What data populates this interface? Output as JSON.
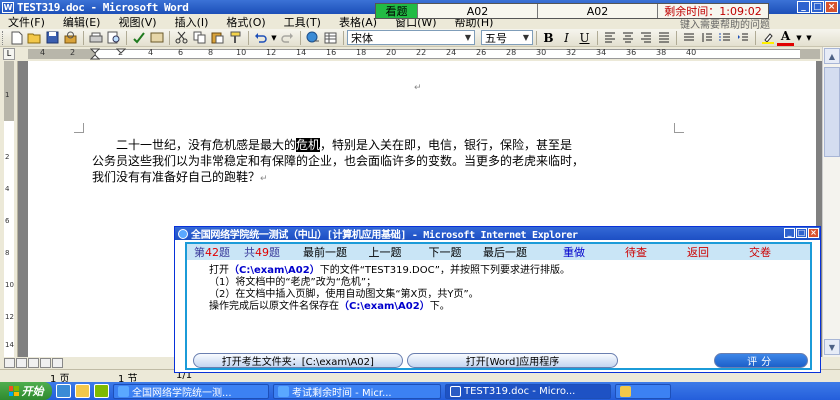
{
  "window": {
    "title": "TEST319.doc - Microsoft Word",
    "icon_label": "W"
  },
  "exam_bar": {
    "watch_label": "看题",
    "answer_1": "A02",
    "answer_2": "A02",
    "timer": "剩余时间：1:09:02"
  },
  "help_hint": "键入需要帮助的问题",
  "menu": [
    "文件(F)",
    "编辑(E)",
    "视图(V)",
    "插入(I)",
    "格式(O)",
    "工具(T)",
    "表格(A)",
    "窗口(W)",
    "帮助(H)"
  ],
  "toolbar": {
    "font_name": "宋体",
    "font_size": "五号",
    "bold": "B",
    "italic": "I",
    "underline": "U",
    "font_color": "A",
    "arrow": "▼"
  },
  "ruler": {
    "numbers": [
      "4",
      "2",
      "2",
      "4",
      "6",
      "8",
      "10",
      "12",
      "14",
      "16",
      "18",
      "20",
      "22",
      "24",
      "26",
      "28",
      "30",
      "32",
      "34",
      "36",
      "38",
      "40"
    ],
    "vertical_numbers": [
      "1",
      "2",
      "4",
      "6",
      "8",
      "10",
      "12",
      "14"
    ]
  },
  "document": {
    "paragraph_mark": "↵",
    "line1_before": "二十一世纪，没有危机感是最大的",
    "selected": "危机",
    "line1_after": "，特别是入关在即，电信，银行，保险，甚至是",
    "line2": "公务员这些我们以为非常稳定和有保障的企业，也会面临许多的变数。当更多的老虎来临时，",
    "line3": "我们没有有准备好自己的跑鞋？"
  },
  "statusbar": {
    "page": "1 页",
    "section": "1 节",
    "pos": "1/1"
  },
  "taskbar": {
    "start": "开始",
    "items": [
      "全国网络学院统一测...",
      "考试剩余时间 - Micr...",
      "TEST319.doc - Micro...",
      ""
    ]
  },
  "exam_dialog": {
    "title": "全国网络学院统一测试（中山）[计算机应用基础] - Microsoft Internet Explorer",
    "nav": {
      "current_prefix": "第",
      "current_num": "42",
      "current_suffix": "题",
      "total_prefix": "共",
      "total_num": "49",
      "total_suffix": "题",
      "first": "最前一题",
      "prev": "上一题",
      "next": "下一题",
      "last": "最后一题",
      "redo": "重做",
      "review": "待查",
      "back": "返回",
      "submit": "交卷"
    },
    "instructions": {
      "line1_a": "打开",
      "line1_path": "（C:\\exam\\A02）",
      "line1_b": "下的文件“TEST319.DOC”，并按照下列要求进行排版。",
      "line2": "（1）将文档中的“老虎”改为“危机”；",
      "line3": "（2）在文档中插入页脚，使用自动图文集“第X页，共Y页”。",
      "line4_a": "操作完成后以原文件名保存在",
      "line4_path": "（C:\\exam\\A02）",
      "line4_b": "下。"
    },
    "buttons": {
      "open_folder": "打开考生文件夹：[C:\\exam\\A02]",
      "open_app": "打开[Word]应用程序",
      "score": "评分"
    }
  },
  "colors": {
    "title_blue": "#1c4fb8",
    "watch_green": "#22bb44",
    "timer_red": "#c00000",
    "nav_bg": "#c9e5f6",
    "dialog_border": "#1b9bd8"
  }
}
